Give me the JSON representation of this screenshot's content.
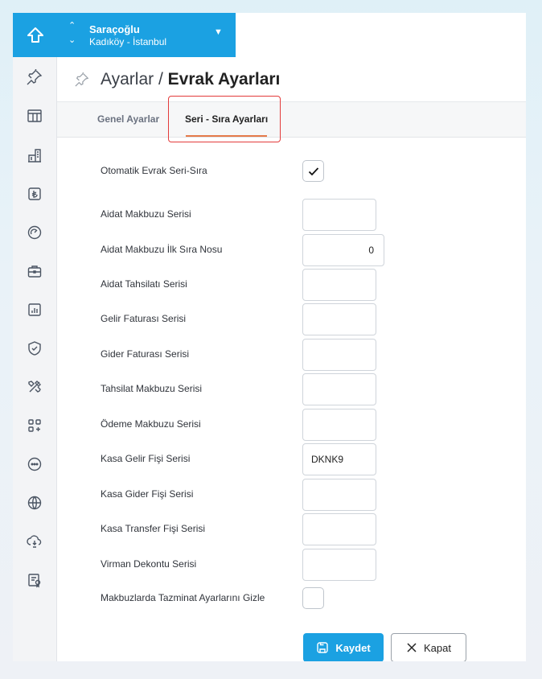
{
  "company": {
    "name": "Saraçoğlu",
    "location": "Kadıköy - İstanbul"
  },
  "breadcrumb": {
    "parent": "Ayarlar",
    "separator": "/",
    "current": "Evrak Ayarları"
  },
  "tabs": [
    {
      "label": "Genel Ayarlar",
      "active": false
    },
    {
      "label": "Seri - Sıra Ayarları",
      "active": true
    }
  ],
  "form": {
    "auto_serial": {
      "label": "Otomatik Evrak Seri-Sıra",
      "checked": true
    },
    "fields": [
      {
        "label": "Aidat Makbuzu Serisi",
        "value": ""
      },
      {
        "label": "Aidat Makbuzu İlk Sıra Nosu",
        "value": "0"
      },
      {
        "label": "Aidat Tahsilatı Serisi",
        "value": ""
      },
      {
        "label": "Gelir Faturası Serisi",
        "value": ""
      },
      {
        "label": "Gider Faturası Serisi",
        "value": ""
      },
      {
        "label": "Tahsilat Makbuzu Serisi",
        "value": ""
      },
      {
        "label": "Ödeme Makbuzu Serisi",
        "value": ""
      },
      {
        "label": "Kasa Gelir Fişi Serisi",
        "value": "DKNK9"
      },
      {
        "label": "Kasa Gider Fişi Serisi",
        "value": ""
      },
      {
        "label": "Kasa Transfer Fişi Serisi",
        "value": ""
      },
      {
        "label": "Virman Dekontu Serisi",
        "value": ""
      }
    ],
    "hide_compensation": {
      "label": "Makbuzlarda Tazminat Ayarlarını Gizle",
      "checked": false
    }
  },
  "actions": {
    "save_label": "Kaydet",
    "close_label": "Kapat"
  },
  "colors": {
    "accent": "#1ba1e2",
    "highlight_border": "#e33b3b",
    "tab_underline": "#e57a4a"
  },
  "sidebar_icons": [
    "pin-icon",
    "layout-table-icon",
    "buildings-icon",
    "lira-icon",
    "gauge-icon",
    "briefcase-icon",
    "chart-icon",
    "shield-check-icon",
    "tools-icon",
    "apps-add-icon",
    "chat-dots-icon",
    "globe-icon",
    "cloud-sync-icon",
    "certificate-icon"
  ]
}
